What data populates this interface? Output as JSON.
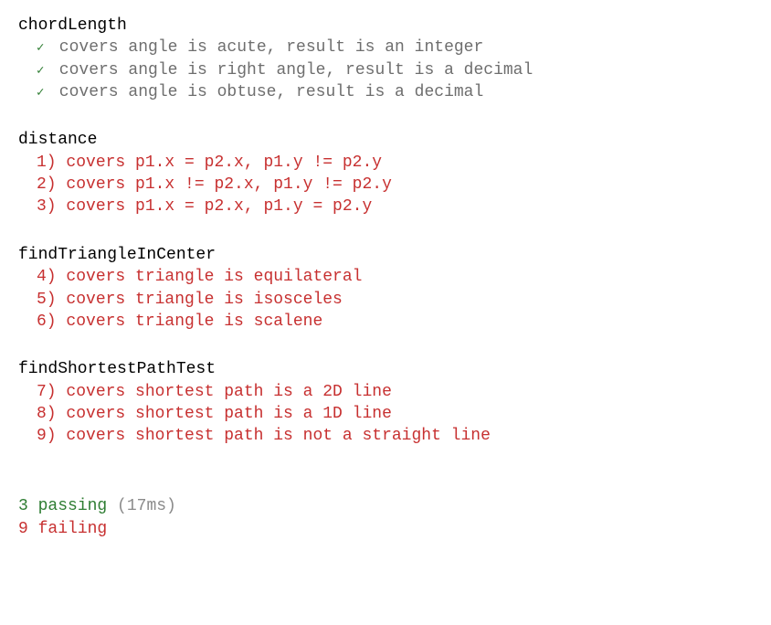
{
  "suites": [
    {
      "title": "chordLength",
      "tests": [
        {
          "status": "pass",
          "marker": "✓",
          "text": "covers angle is acute, result is an integer"
        },
        {
          "status": "pass",
          "marker": "✓",
          "text": "covers angle is right angle, result is a decimal"
        },
        {
          "status": "pass",
          "marker": "✓",
          "text": "covers angle is obtuse, result is a decimal"
        }
      ]
    },
    {
      "title": "distance",
      "tests": [
        {
          "status": "fail",
          "marker": "1)",
          "text": "covers p1.x = p2.x, p1.y != p2.y"
        },
        {
          "status": "fail",
          "marker": "2)",
          "text": "covers p1.x != p2.x, p1.y != p2.y"
        },
        {
          "status": "fail",
          "marker": "3)",
          "text": "covers p1.x = p2.x, p1.y = p2.y"
        }
      ]
    },
    {
      "title": "findTriangleInCenter",
      "tests": [
        {
          "status": "fail",
          "marker": "4)",
          "text": "covers triangle is equilateral"
        },
        {
          "status": "fail",
          "marker": "5)",
          "text": "covers triangle is isosceles"
        },
        {
          "status": "fail",
          "marker": "6)",
          "text": "covers triangle is scalene"
        }
      ]
    },
    {
      "title": "findShortestPathTest",
      "tests": [
        {
          "status": "fail",
          "marker": "7)",
          "text": "covers shortest path is a 2D line"
        },
        {
          "status": "fail",
          "marker": "8)",
          "text": "covers shortest path is a 1D line"
        },
        {
          "status": "fail",
          "marker": "9)",
          "text": "covers shortest path is not a straight line"
        }
      ]
    }
  ],
  "summary": {
    "passing_count": "3",
    "passing_label": "passing",
    "time": "(17ms)",
    "failing_count": "9",
    "failing_label": "failing"
  }
}
